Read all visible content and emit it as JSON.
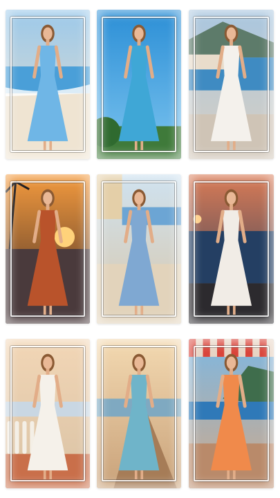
{
  "gallery": {
    "tiles": [
      {
        "name": "photo-beach-blue-dress",
        "scene": "beach",
        "dress_color": "#6fb6e6",
        "bg_top": "#9cc9ea",
        "bg_bottom": "#eadfcd"
      },
      {
        "name": "photo-crop-top-shorts",
        "scene": "sky",
        "dress_color": "#3fa7d6",
        "bg_top": "#2c8fd6",
        "bg_bottom": "#7cc4ef"
      },
      {
        "name": "photo-harbor-white-dress",
        "scene": "harbor",
        "dress_color": "#f4f1ec",
        "bg_top": "#a9c6df",
        "bg_bottom": "#d8cfc2"
      },
      {
        "name": "photo-sunset-orange-dress",
        "scene": "sunset",
        "dress_color": "#b9532b",
        "bg_top": "#f39a3e",
        "bg_bottom": "#3d2a26"
      },
      {
        "name": "photo-terrace-blue-skirt",
        "scene": "terrace",
        "dress_color": "#7fa8d2",
        "bg_top": "#cfe2f0",
        "bg_bottom": "#d9c7aa"
      },
      {
        "name": "photo-sea-view-sunset",
        "scene": "seaview",
        "dress_color": "#f1ece6",
        "bg_top": "#d97b56",
        "bg_bottom": "#1f3b5c"
      },
      {
        "name": "photo-balcony-white-dress",
        "scene": "balcony",
        "dress_color": "#f5f1ea",
        "bg_top": "#f2d6b6",
        "bg_bottom": "#d9c2a4"
      },
      {
        "name": "photo-pier-teal-dress",
        "scene": "pier",
        "dress_color": "#6fb4c9",
        "bg_top": "#f3d9b1",
        "bg_bottom": "#c9a27a"
      },
      {
        "name": "photo-cafe-orange-skirt",
        "scene": "cafe",
        "dress_color": "#f08a4b",
        "bg_top": "#7fb7e0",
        "bg_bottom": "#cfa98a"
      }
    ]
  }
}
